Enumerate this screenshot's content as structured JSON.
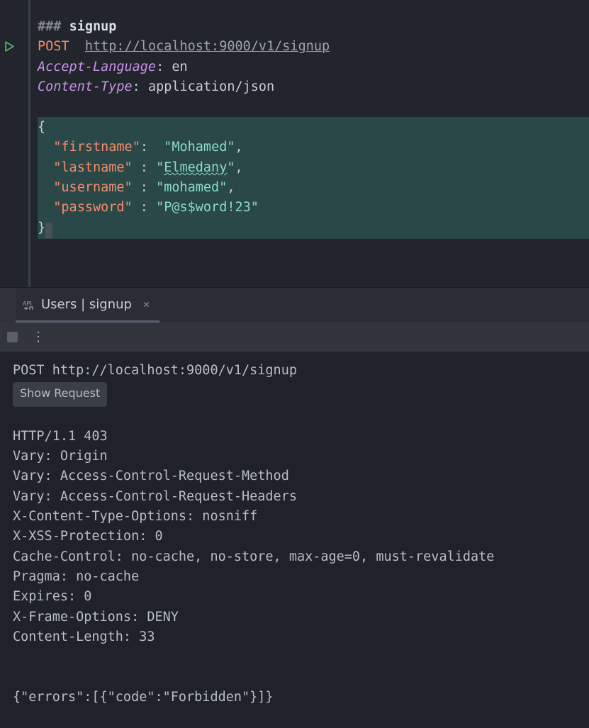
{
  "editor": {
    "section_marker": "###",
    "section_name": "signup",
    "method": "POST",
    "url": "http://localhost:9000/v1/signup",
    "headers": [
      {
        "name": "Accept-Language",
        "value": "en"
      },
      {
        "name": "Content-Type",
        "value": "application/json"
      }
    ],
    "body": {
      "open": "{",
      "close": "}",
      "fields": [
        {
          "key_quoted": "\"firstname\"",
          "sep": ":",
          "val_open": "\"",
          "val_text": "Mohamed",
          "val_close": "\"",
          "trailing": ",",
          "spell_underline": false
        },
        {
          "key_quoted": "\"lastname\"",
          "sep": " :",
          "val_open": "\"",
          "val_text": "Elmedany",
          "val_close": "\"",
          "trailing": ",",
          "spell_underline": true
        },
        {
          "key_quoted": "\"username\"",
          "sep": " :",
          "val_open": "\"",
          "val_text": "mohamed",
          "val_close": "\"",
          "trailing": ",",
          "spell_underline": false
        },
        {
          "key_quoted": "\"password\"",
          "sep": " :",
          "val_open": "\"",
          "val_text": "P@s$word!23",
          "val_close": "\"",
          "trailing": "",
          "spell_underline": false
        }
      ]
    },
    "run_icon": "run-icon"
  },
  "tab": {
    "label": "Users | signup",
    "close": "✕",
    "icon": "api-icon"
  },
  "toolbar": {
    "stop": "stop-icon",
    "more": "⋮"
  },
  "response": {
    "request_line": "POST http://localhost:9000/v1/signup",
    "show_request_label": "Show Request",
    "lines": [
      "HTTP/1.1 403",
      "Vary: Origin",
      "Vary: Access-Control-Request-Method",
      "Vary: Access-Control-Request-Headers",
      "X-Content-Type-Options: nosniff",
      "X-XSS-Protection: 0",
      "Cache-Control: no-cache, no-store, max-age=0, must-revalidate",
      "Pragma: no-cache",
      "Expires: 0",
      "X-Frame-Options: DENY",
      "Content-Length: 33"
    ],
    "body": "{\"errors\":[{\"code\":\"Forbidden\"}]}"
  }
}
